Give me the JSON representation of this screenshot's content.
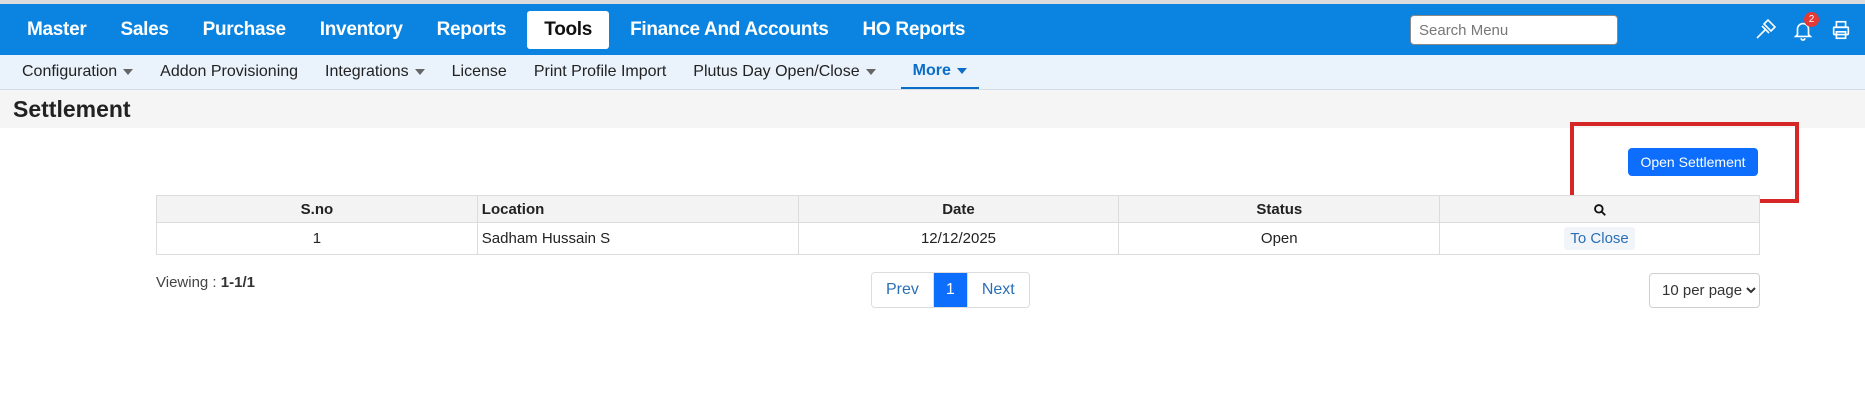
{
  "topnav": {
    "items": [
      {
        "label": "Master"
      },
      {
        "label": "Sales"
      },
      {
        "label": "Purchase"
      },
      {
        "label": "Inventory"
      },
      {
        "label": "Reports"
      },
      {
        "label": "Tools",
        "active": true
      },
      {
        "label": "Finance And Accounts"
      },
      {
        "label": "HO Reports"
      }
    ],
    "search_placeholder": "Search Menu",
    "icons": [
      "hammer-icon",
      "bell-icon",
      "printer-icon"
    ],
    "notification_count": "2"
  },
  "subnav": {
    "items": [
      {
        "label": "Configuration",
        "dropdown": true
      },
      {
        "label": "Addon Provisioning",
        "dropdown": false
      },
      {
        "label": "Integrations",
        "dropdown": true
      },
      {
        "label": "License",
        "dropdown": false
      },
      {
        "label": "Print Profile Import",
        "dropdown": false
      },
      {
        "label": "Plutus Day Open/Close",
        "dropdown": true
      },
      {
        "label": "More",
        "dropdown": true,
        "active": true
      }
    ]
  },
  "page": {
    "title": "Settlement",
    "open_button_label": "Open Settlement",
    "highlight_color": "#d62727"
  },
  "table": {
    "headers": [
      "S.no",
      "Location",
      "Date",
      "Status"
    ],
    "search_icon": "search-icon",
    "rows": [
      {
        "sno": "1",
        "location": "Sadham Hussain S",
        "date": "12/12/2025",
        "status": "Open",
        "action": "To Close"
      }
    ]
  },
  "footer": {
    "viewing_label": "Viewing :",
    "viewing_range": "1-1/1",
    "prev_label": "Prev",
    "current_page": "1",
    "next_label": "Next",
    "per_page_selected": "10 per page"
  },
  "colors": {
    "nav_blue": "#0a84e0",
    "primary_button": "#0d6efd",
    "link": "#2a6fb5"
  }
}
